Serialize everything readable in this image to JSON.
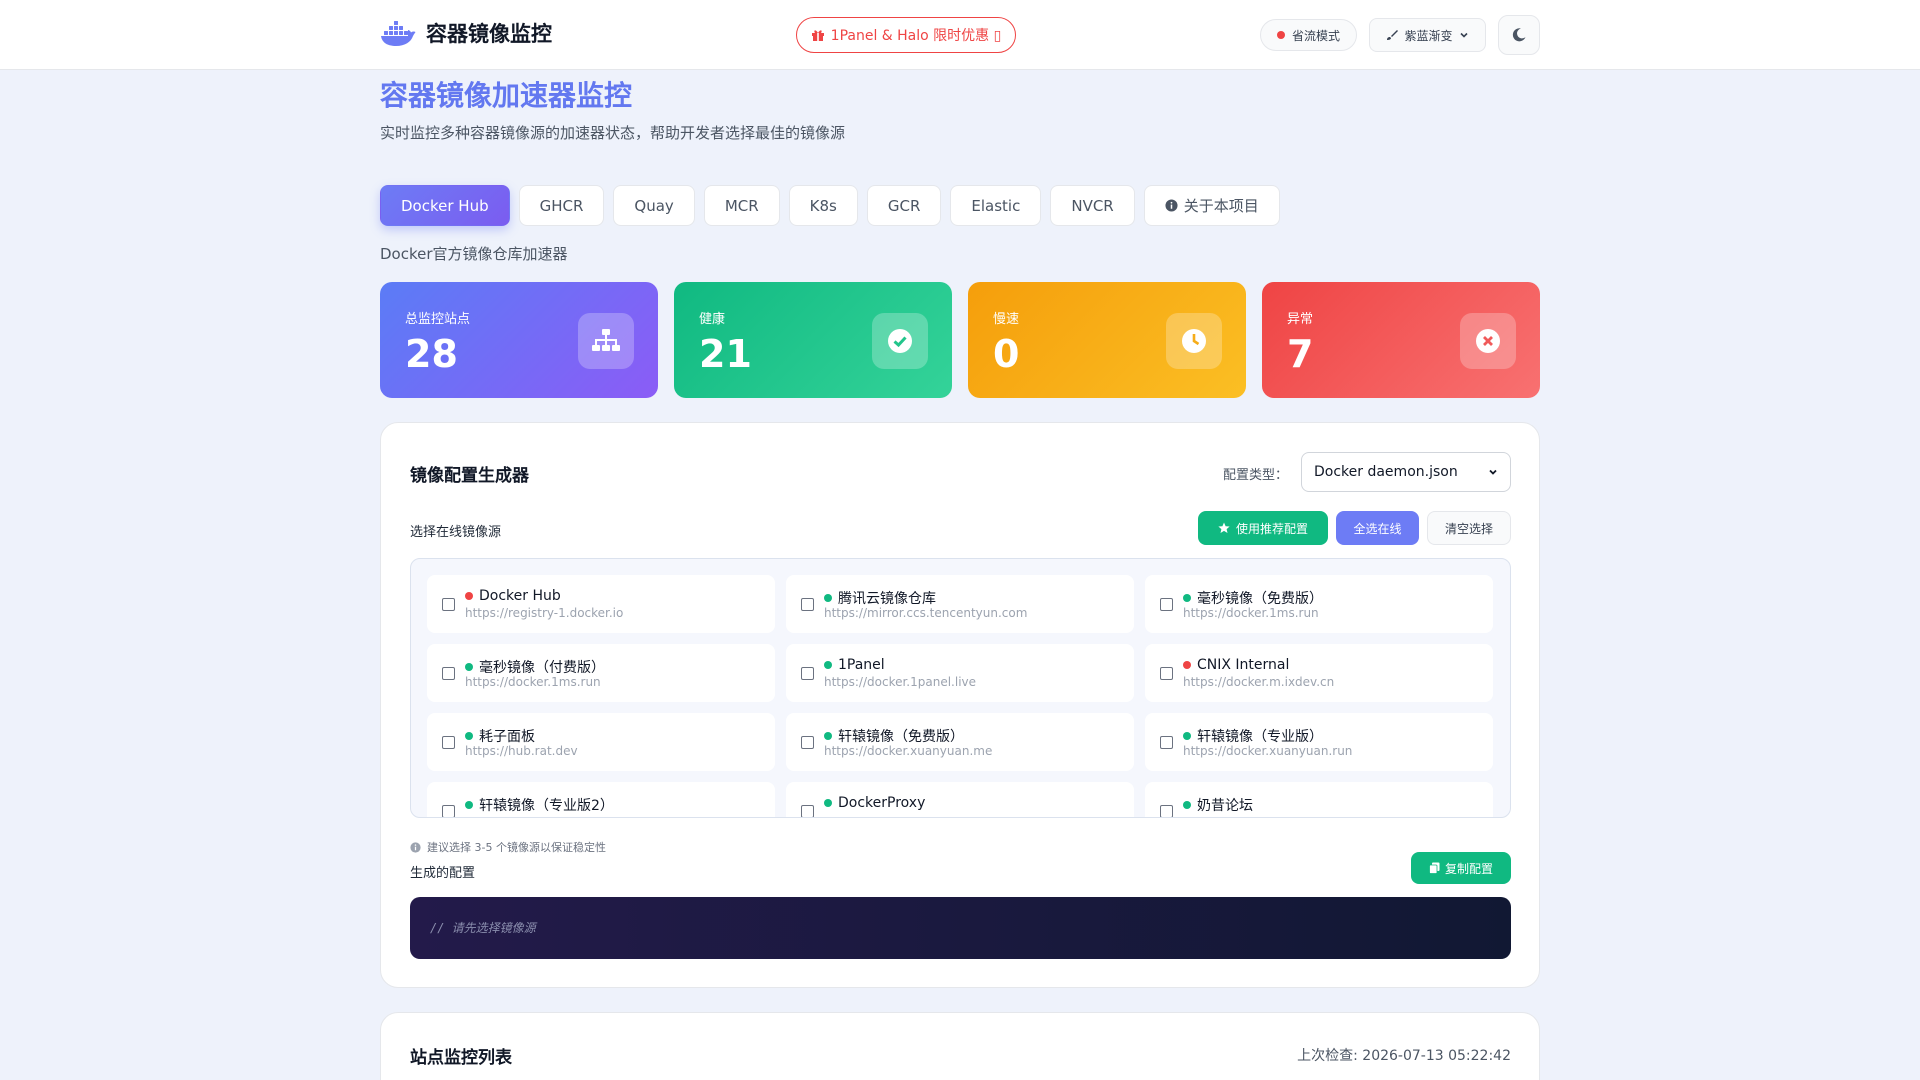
{
  "header": {
    "title": "容器镜像监控",
    "promo": "1Panel & Halo 限时优惠 ▯",
    "eco_mode": "省流模式",
    "theme": "紫蓝渐变"
  },
  "hero": {
    "title": "容器镜像加速器监控",
    "subtitle": "实时监控多种容器镜像源的加速器状态，帮助开发者选择最佳的镜像源"
  },
  "tabs": [
    {
      "label": "Docker Hub",
      "active": true
    },
    {
      "label": "GHCR"
    },
    {
      "label": "Quay"
    },
    {
      "label": "MCR"
    },
    {
      "label": "K8s"
    },
    {
      "label": "GCR"
    },
    {
      "label": "Elastic"
    },
    {
      "label": "NVCR"
    },
    {
      "label": "关于本项目"
    }
  ],
  "tab_description": "Docker官方镜像仓库加速器",
  "stats": [
    {
      "label": "总监控站点",
      "value": "28",
      "color_from": "#5b7cf6",
      "color_to": "#8b5cf6",
      "icon": "sitemap-icon"
    },
    {
      "label": "健康",
      "value": "21",
      "color_from": "#10b981",
      "color_to": "#34d399",
      "icon": "check-circle-icon"
    },
    {
      "label": "慢速",
      "value": "0",
      "color_from": "#f59e0b",
      "color_to": "#fbbf24",
      "icon": "clock-icon"
    },
    {
      "label": "异常",
      "value": "7",
      "color_from": "#ef4444",
      "color_to": "#f87171",
      "icon": "times-circle-icon"
    }
  ],
  "generator": {
    "title": "镜像配置生成器",
    "config_type_label": "配置类型：",
    "config_type_value": "Docker daemon.json",
    "select_label": "选择在线镜像源",
    "btn_recommended": "使用推荐配置",
    "btn_select_all": "全选在线",
    "btn_clear": "清空选择",
    "mirrors": [
      {
        "name": "Docker Hub",
        "url": "https://registry-1.docker.io",
        "status": "down"
      },
      {
        "name": "腾讯云镜像仓库",
        "url": "https://mirror.ccs.tencentyun.com",
        "status": "ok"
      },
      {
        "name": "毫秒镜像（免费版）",
        "url": "https://docker.1ms.run",
        "status": "ok"
      },
      {
        "name": "毫秒镜像（付费版）",
        "url": "https://docker.1ms.run",
        "status": "ok"
      },
      {
        "name": "1Panel",
        "url": "https://docker.1panel.live",
        "status": "ok"
      },
      {
        "name": "CNIX Internal",
        "url": "https://docker.m.ixdev.cn",
        "status": "down"
      },
      {
        "name": "耗子面板",
        "url": "https://hub.rat.dev",
        "status": "ok"
      },
      {
        "name": "轩辕镜像（免费版）",
        "url": "https://docker.xuanyuan.me",
        "status": "ok"
      },
      {
        "name": "轩辕镜像（专业版）",
        "url": "https://docker.xuanyuan.run",
        "status": "ok"
      },
      {
        "name": "轩辕镜像（专业版2）",
        "url": "",
        "status": "ok"
      },
      {
        "name": "DockerProxy",
        "url": "",
        "status": "ok"
      },
      {
        "name": "奶昔论坛",
        "url": "",
        "status": "ok"
      }
    ],
    "tip": "建议选择 3-5 个镜像源以保证稳定性",
    "generated_label": "生成的配置",
    "btn_copy": "复制配置",
    "code_placeholder": "// 请先选择镜像源"
  },
  "monitor_list": {
    "title": "站点监控列表",
    "last_check": "上次检查: 2026-07-13 05:22:42"
  },
  "colors": {
    "accent": "#6378f0",
    "ok": "#10b981",
    "down": "#ef4444"
  }
}
